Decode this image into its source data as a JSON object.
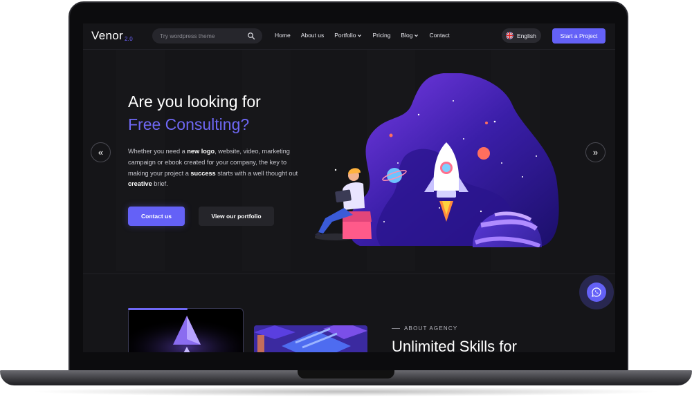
{
  "logo": {
    "name": "Venor",
    "version": "2.0"
  },
  "search": {
    "placeholder": "Try wordpress theme"
  },
  "nav": {
    "items": [
      {
        "label": "Home"
      },
      {
        "label": "About us"
      },
      {
        "label": "Portfolio",
        "has_dropdown": true
      },
      {
        "label": "Pricing"
      },
      {
        "label": "Blog",
        "has_dropdown": true
      },
      {
        "label": "Contact"
      }
    ],
    "language": "English",
    "cta": "Start a Project"
  },
  "hero": {
    "title_line1": "Are you looking for",
    "title_line2": "Free Consulting?",
    "desc_part1": "Whether you need a ",
    "desc_bold1": "new logo",
    "desc_part2": ", website, video, marketing campaign or ebook created for your company, the key to making your project a ",
    "desc_bold2": "success",
    "desc_part3": " starts with a well thought out ",
    "desc_bold3": "creative",
    "desc_part4": " brief.",
    "primary_button": "Contact us",
    "secondary_button": "View our portfolio",
    "prev_arrow": "«",
    "next_arrow": "»"
  },
  "about": {
    "kicker": "ABOUT AGENCY",
    "title": "Unlimited Skills for"
  },
  "colors": {
    "accent": "#6461f7",
    "background": "#151518",
    "purple_title": "#6f68f5"
  },
  "icons": {
    "search": "search-icon",
    "whatsapp": "whatsapp-icon",
    "flag": "uk-flag-icon"
  }
}
